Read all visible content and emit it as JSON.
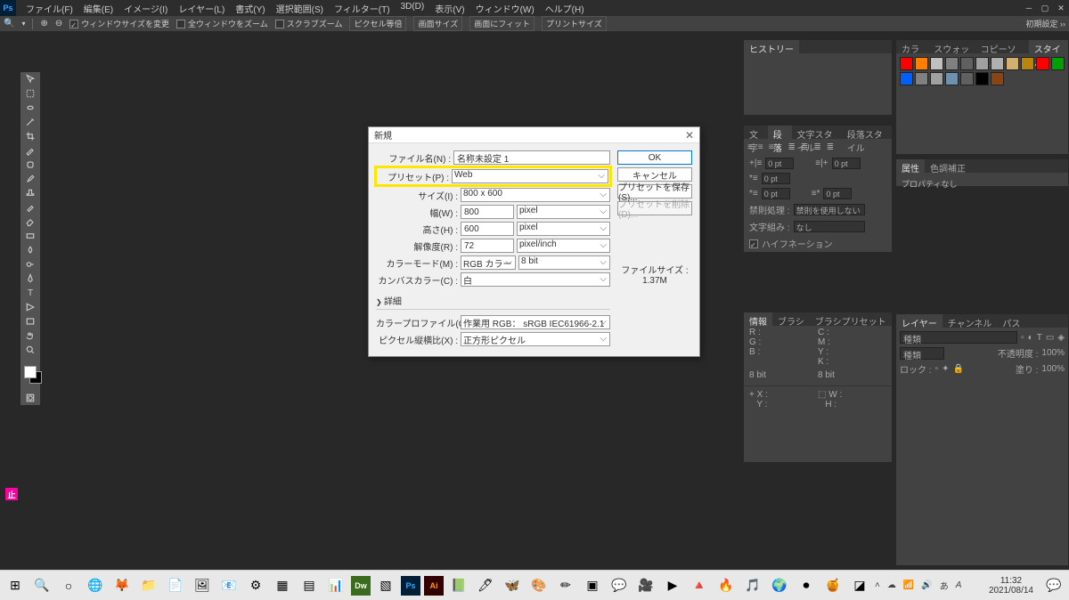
{
  "menu": [
    "ファイル(F)",
    "編集(E)",
    "イメージ(I)",
    "レイヤー(L)",
    "書式(Y)",
    "選択範囲(S)",
    "フィルター(T)",
    "3D(D)",
    "表示(V)",
    "ウィンドウ(W)",
    "ヘルプ(H)"
  ],
  "optbar": {
    "chk1": "ウィンドウサイズを変更",
    "chk2": "全ウィンドウをズーム",
    "chk3": "スクラブズーム",
    "btn1": "ピクセル等倍",
    "btn2": "画面サイズ",
    "btn3": "画面にフィット",
    "btn4": "プリントサイズ",
    "right": "初期設定 ››"
  },
  "dialog": {
    "title": "新規",
    "labels": {
      "name": "ファイル名(N) :",
      "preset": "プリセット(P) :",
      "size": "サイズ(I) :",
      "width": "幅(W) :",
      "height": "高さ(H) :",
      "res": "解像度(R) :",
      "cmode": "カラーモード(M) :",
      "canvas": "カンバスカラー(C) :",
      "profile": "カラープロファイル(O) :",
      "pixel": "ピクセル縦横比(X) :"
    },
    "values": {
      "name": "名称未設定 1",
      "preset": "Web",
      "size": "800 x 600",
      "width": "800",
      "height": "600",
      "res": "72",
      "cmode": "RGB カラー",
      "bits": "8 bit",
      "canvas": "白",
      "profile": "作業用 RGB： sRGB IEC61966-2.1",
      "pixel": "正方形ピクセル",
      "wunit": "pixel",
      "hunit": "pixel",
      "runit": "pixel/inch"
    },
    "expand": "詳細",
    "buttons": {
      "ok": "OK",
      "cancel": "キャンセル",
      "save": "プリセットを保存(S)...",
      "delete": "プリセットを削除(D)..."
    },
    "filesize": {
      "label": "ファイルサイズ :",
      "value": "1.37M"
    }
  },
  "panels": {
    "history": "ヒストリー",
    "color_tabs": [
      "カラー",
      "スウォッチ",
      "コピーソース",
      "スタイル"
    ],
    "char_tabs": [
      "文字",
      "段落",
      "文字スタイル",
      "段落スタイル"
    ],
    "prop_tabs": [
      "属性",
      "色調補正"
    ],
    "prop_body": "プロパティなし",
    "info_tabs": [
      "情報",
      "ブラシ",
      "ブラシプリセット"
    ],
    "layer_tabs": [
      "レイヤー",
      "チャンネル",
      "パス"
    ],
    "para": {
      "pt": "0 pt",
      "kinsoku_l": "禁則処理 :",
      "kinsoku_v": "禁則を使用しない",
      "moji_l": "文字組み :",
      "moji_v": "なし",
      "hyph": "ハイフネーション"
    },
    "info": {
      "r": "R :",
      "g": "G :",
      "b": "B :",
      "c": "C :",
      "m": "M :",
      "y": "Y :",
      "k": "K :",
      "bit": "8 bit",
      "x": "X :",
      "yy": "Y :",
      "w": "W :",
      "h": "H :"
    },
    "layer": {
      "kind": "種類",
      "opacity_l": "不透明度 :",
      "opacity_v": "100%",
      "lock": "ロック :",
      "fill_l": "塗り :",
      "fill_v": "100%"
    }
  },
  "swatches": [
    "#ff0000",
    "#ff8000",
    "#c0c0c0",
    "#808080",
    "#606060",
    "#a0a0a0",
    "#b0b0b0",
    "#d4b070",
    "#b8860b",
    "#ff0000",
    "#00a000",
    "#0060ff",
    "#808080",
    "#a0a0a0",
    "#7090b0",
    "#606060",
    "#000000",
    "#8b4513"
  ],
  "taskbar": {
    "time": "11:32",
    "date": "2021/08/14"
  },
  "ime": "止"
}
